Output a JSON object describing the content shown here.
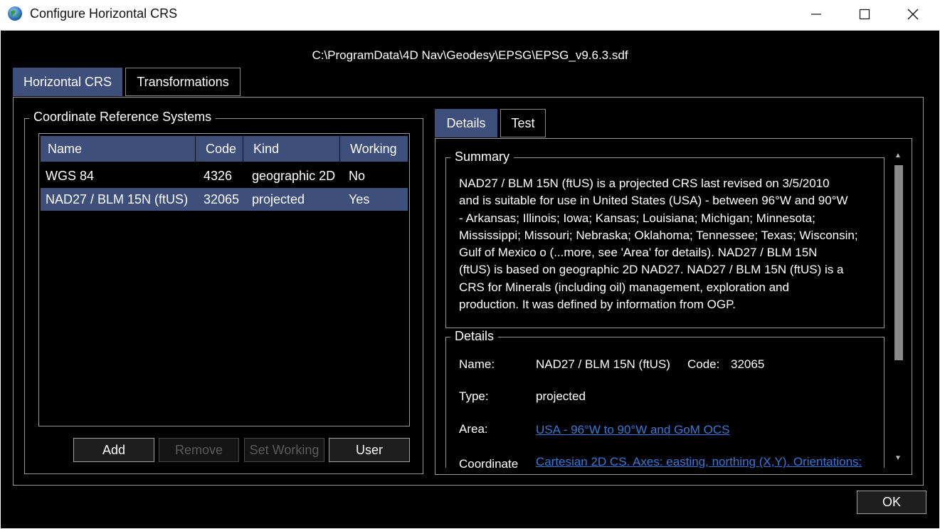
{
  "window": {
    "title": "Configure Horizontal CRS",
    "minimize_icon": "minimize-icon",
    "maximize_icon": "maximize-icon",
    "close_icon": "close-icon"
  },
  "path": "C:\\ProgramData\\4D Nav\\Geodesy\\EPSG\\EPSG_v9.6.3.sdf",
  "main_tabs": [
    {
      "label": "Horizontal CRS",
      "active": true
    },
    {
      "label": "Transformations",
      "active": false
    }
  ],
  "crs_group": {
    "title": "Coordinate Reference Systems",
    "columns": [
      "Name",
      "Code",
      "Kind",
      "Working"
    ],
    "rows": [
      {
        "name": "WGS 84",
        "code": "4326",
        "kind": "geographic 2D",
        "working": "No",
        "selected": false
      },
      {
        "name": "NAD27 / BLM 15N (ftUS)",
        "code": "32065",
        "kind": "projected",
        "working": "Yes",
        "selected": true
      }
    ],
    "buttons": {
      "add": "Add",
      "remove": "Remove",
      "set_working": "Set Working",
      "user": "User"
    }
  },
  "detail_tabs": [
    {
      "label": "Details",
      "active": true
    },
    {
      "label": "Test",
      "active": false
    }
  ],
  "summary": {
    "title": "Summary",
    "lines": [
      "NAD27 / BLM 15N (ftUS) is a projected CRS last revised on 3/5/2010",
      "and is suitable for use in United States (USA) - between 96°W and 90°W",
      "- Arkansas; Illinois; Iowa; Kansas; Louisiana; Michigan; Minnesota;",
      "Mississippi; Missouri; Nebraska; Oklahoma; Tennessee; Texas; Wisconsin;",
      "Gulf of Mexico o (...more, see 'Area' for details). NAD27 / BLM 15N",
      "(ftUS) is based on geographic 2D NAD27. NAD27 / BLM 15N (ftUS) is a",
      "CRS for Minerals (including oil) management, exploration and",
      "production. It was defined by information from OGP."
    ]
  },
  "details": {
    "title": "Details",
    "name_label": "Name:",
    "name_value": "NAD27 / BLM 15N (ftUS)",
    "code_label": "Code:",
    "code_value": "32065",
    "type_label": "Type:",
    "type_value": "projected",
    "area_label": "Area:",
    "area_value": "USA - 96°W to 90°W and GoM OCS",
    "coordinate_label": "Coordinate",
    "coordinate_value": "Cartesian 2D CS. Axes: easting, northing (X,Y). Orientations:"
  },
  "ok_button": "OK",
  "colors": {
    "background": "#000000",
    "selection": "#3d4f7a",
    "link": "#3a78d8",
    "border": "#9a9a9a"
  }
}
